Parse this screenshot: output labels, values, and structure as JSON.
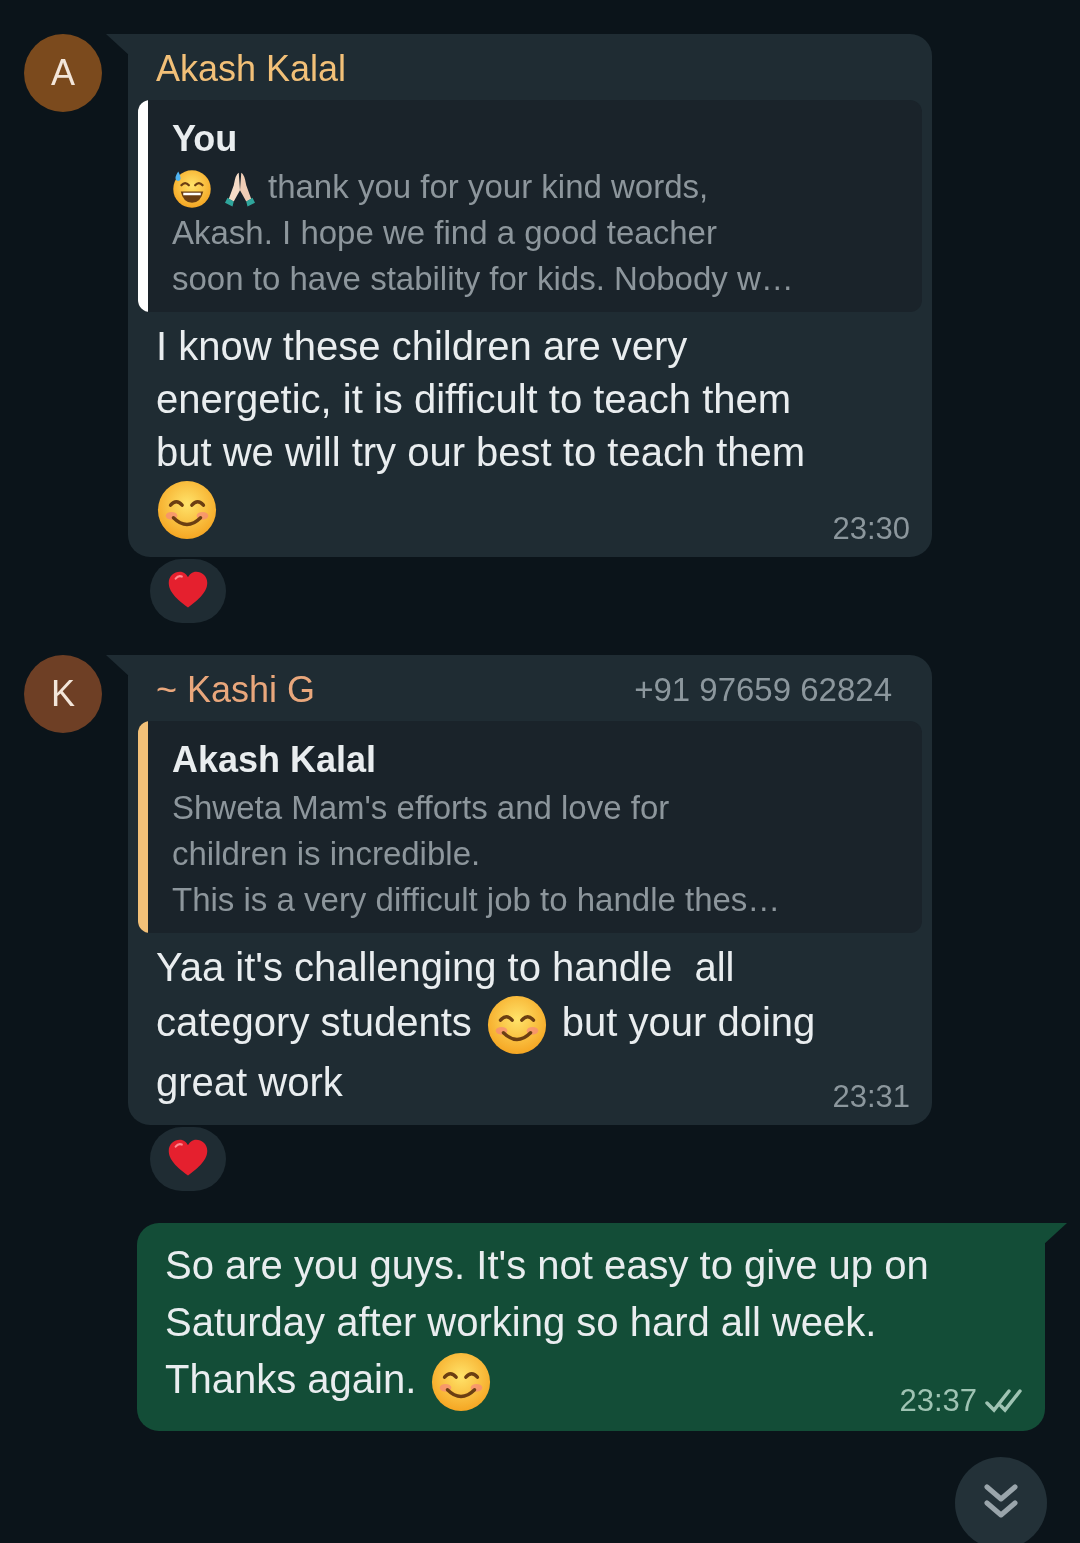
{
  "messages": [
    {
      "kind": "incoming",
      "avatar": {
        "letter": "A",
        "color": "#7b4a1d"
      },
      "sender": {
        "name": "Akash Kalal",
        "color": "#f2c078"
      },
      "quote": {
        "author": "You",
        "color": "#ffffff",
        "parts": [
          {
            "kind": "sweat-smile"
          },
          {
            "kind": "pray"
          },
          {
            "kind": "text",
            "text": "thank you for your kind words,"
          },
          {
            "kind": "break"
          },
          {
            "kind": "text",
            "text": "Akash. I hope we find a good teacher"
          },
          {
            "kind": "break"
          },
          {
            "kind": "text",
            "text": "soon to have stability for kids. Nobody w…"
          }
        ]
      },
      "parts": [
        {
          "kind": "text",
          "text": "I know these children are very"
        },
        {
          "kind": "break"
        },
        {
          "kind": "text",
          "text": "energetic, it is difficult to teach them"
        },
        {
          "kind": "break"
        },
        {
          "kind": "text",
          "text": "but we will try our best to teach them"
        },
        {
          "kind": "break"
        },
        {
          "kind": "smile"
        }
      ],
      "time": "23:30",
      "reaction": {
        "kind": "heart"
      }
    },
    {
      "kind": "incoming",
      "avatar": {
        "letter": "K",
        "color": "#6e3f25"
      },
      "sender": {
        "name": "~ Kashi G",
        "color": "#e9a77c"
      },
      "phone": "+91 97659 62824",
      "quote": {
        "author": "Akash Kalal",
        "color": "#f2c078",
        "parts": [
          {
            "kind": "text",
            "text": "Shweta Mam's efforts and love for"
          },
          {
            "kind": "break"
          },
          {
            "kind": "text",
            "text": "children is incredible."
          },
          {
            "kind": "break"
          },
          {
            "kind": "text",
            "text": "This is a very difficult job to handle thes…"
          }
        ]
      },
      "parts": [
        {
          "kind": "text",
          "text": "Yaa it's challenging to handle  all"
        },
        {
          "kind": "break"
        },
        {
          "kind": "text",
          "text": "category students"
        },
        {
          "kind": "smile"
        },
        {
          "kind": "text",
          "text": "but your doing"
        },
        {
          "kind": "break"
        },
        {
          "kind": "text",
          "text": "great work"
        }
      ],
      "time": "23:31",
      "reaction": {
        "kind": "heart"
      }
    },
    {
      "kind": "outgoing",
      "parts": [
        {
          "kind": "text",
          "text": "So are you guys. It's not easy to give up on"
        },
        {
          "kind": "break"
        },
        {
          "kind": "text",
          "text": "Saturday after working so hard all week."
        },
        {
          "kind": "break"
        },
        {
          "kind": "text",
          "text": "Thanks again."
        },
        {
          "kind": "smile"
        }
      ],
      "time": "23:37",
      "read": false
    }
  ]
}
